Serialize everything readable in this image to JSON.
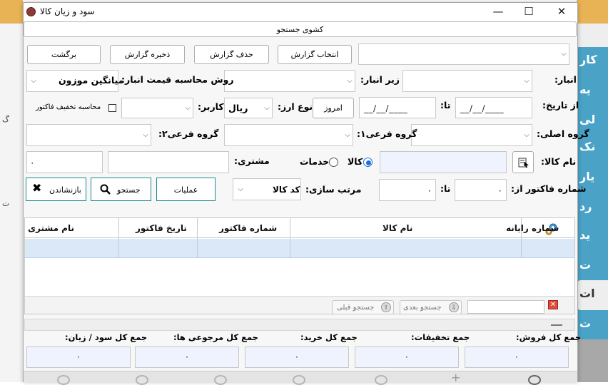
{
  "window": {
    "title": "سود و زیان کالا",
    "minimize": "—",
    "maximize": "☐",
    "close": "✕"
  },
  "search_drawer": {
    "label": "کشوی جستجو"
  },
  "toolbar": {
    "back": "برگشت",
    "save_report": "ذخیره گزارش",
    "delete_report": "حذف گزارش",
    "select_report": "انتخاب گزارش"
  },
  "filters": {
    "warehouse_label": "انبار:",
    "sub_warehouse_label": "زیر انبار:",
    "pricing_method_label": "روش محاسبه قیمت انبار:",
    "pricing_method_value": "میانگین موزون",
    "from_date_label": "از تاریخ:",
    "from_date_value": "__/__/____",
    "to_label": "تا:",
    "to_date_value": "__/__/____",
    "today_button": "امروز",
    "currency_type_label": "نوع ارز:",
    "currency_value": "ریال",
    "user_label": "کاربر:",
    "invoice_discount_label": "محاسبه تخفیف فاکتور",
    "main_group_label": "گروه اصلی:",
    "sub_group1_label": "گروه فرعی۱:",
    "sub_group2_label": "گروه فرعی۲:",
    "product_name_label": "نام کالا:",
    "type_goods": "کالا",
    "type_services": "خدمات",
    "customer_label": "مشتری:",
    "customer_value": "۰",
    "invoice_from_label": "شماره فاکتور از:",
    "invoice_from_value": "۰",
    "invoice_to_label": "تا:",
    "invoice_to_value": "۰",
    "sort_label": "مرتب سازی:",
    "sort_value": "کد کالا"
  },
  "actions": {
    "operations": "عملیات",
    "search": "جستجو",
    "reset": "بازنشاندن"
  },
  "grid": {
    "columns": [
      "شماره رایانه",
      "نام کالا",
      "شماره فاکتور",
      "تاریخ فاکتور",
      "نام مشتری"
    ],
    "next_search": "جستجو بعدی",
    "prev_search": "جستجو قبلی"
  },
  "totals": {
    "total_sales_label": "جمع کل فروش:",
    "total_sales": "۰",
    "total_discounts_label": "جمع تخفیفات:",
    "total_discounts": "۰",
    "total_purchase_label": "جمع کل خرید:",
    "total_purchase": "۰",
    "total_returns_label": "جمع کل مرجوعی ها:",
    "total_returns": "۰",
    "total_profit_label": "جمع کل سود / زیان:",
    "total_profit": "۰"
  },
  "background_tabs": [
    "کار",
    "یه",
    "لی",
    "نک",
    "یار",
    "رد",
    "ید",
    "ت",
    "ات",
    "ت"
  ],
  "background_left": [
    "گ",
    "ت"
  ],
  "colors": {
    "accent_orange": "#e7b355",
    "tab_blue": "#4aa3c6",
    "field_blue": "#eef3fd",
    "selection_blue": "#dbe8f7",
    "close_red": "#e04a3a",
    "radio_blue": "#1e6fd9"
  }
}
